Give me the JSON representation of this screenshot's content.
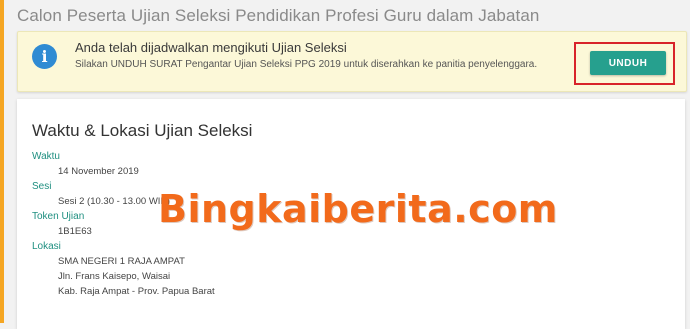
{
  "page": {
    "title": "Calon Peserta Ujian Seleksi Pendidikan Profesi Guru dalam Jabatan"
  },
  "alert": {
    "icon": "info-icon",
    "title": "Anda telah dijadwalkan mengikuti Ujian Seleksi",
    "message": "Silakan UNDUH SURAT Pengantar Ujian Seleksi PPG 2019 untuk diserahkan ke panitia penyelenggara.",
    "button_label": "UNDUH"
  },
  "card": {
    "title": "Waktu & Lokasi Ujian Seleksi",
    "waktu": {
      "label": "Waktu",
      "value": "14 November 2019"
    },
    "sesi": {
      "label": "Sesi",
      "value": "Sesi 2 (10.30 - 13.00 WIB)"
    },
    "token": {
      "label": "Token Ujian",
      "value": "1B1E63"
    },
    "lokasi": {
      "label": "Lokasi",
      "line1": "SMA NEGERI 1 RAJA AMPAT",
      "line2": "Jln. Frans Kaisepo, Waisai",
      "line3": "Kab. Raja Ampat - Prov. Papua Barat"
    }
  },
  "watermark": {
    "text": "Bingkaiberita.com"
  },
  "colors": {
    "accent": "#26a08e",
    "alert_bg": "#fcf8d8",
    "highlight": "#d8232a",
    "watermark": "#f26a1b",
    "info": "#2f8bd3"
  }
}
